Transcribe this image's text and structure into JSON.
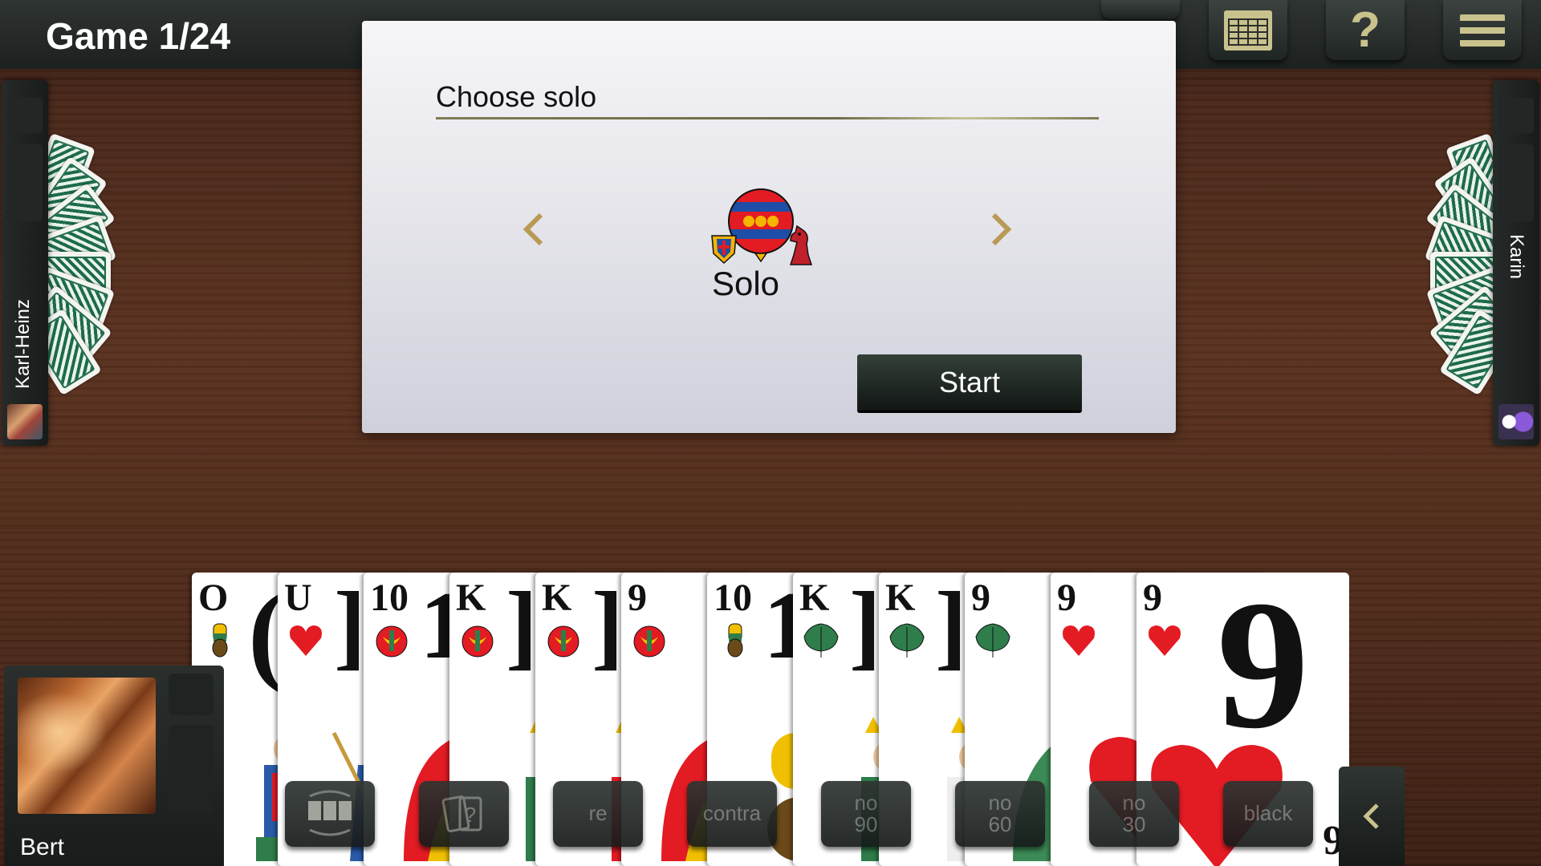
{
  "header": {
    "game_counter": "Game 1/24",
    "buttons": [
      {
        "name": "scoresheet-icon"
      },
      {
        "name": "help-icon"
      },
      {
        "name": "menu-icon"
      }
    ]
  },
  "opponents": {
    "left": {
      "name": "Karl-Heinz"
    },
    "right": {
      "name": "Karin"
    }
  },
  "dialog": {
    "title": "Choose solo",
    "selected_game": "Solo",
    "prev_label": "‹",
    "next_label": "›",
    "start_label": "Start"
  },
  "hand": {
    "cards": [
      {
        "rank": "O",
        "suit": "acorn"
      },
      {
        "rank": "U",
        "suit": "heart"
      },
      {
        "rank": "10",
        "suit": "bell"
      },
      {
        "rank": "K",
        "suit": "bell"
      },
      {
        "rank": "K",
        "suit": "bell"
      },
      {
        "rank": "9",
        "suit": "bell"
      },
      {
        "rank": "10",
        "suit": "acorn"
      },
      {
        "rank": "K",
        "suit": "leaf"
      },
      {
        "rank": "K",
        "suit": "leaf"
      },
      {
        "rank": "9",
        "suit": "leaf"
      },
      {
        "rank": "9",
        "suit": "heart"
      },
      {
        "rank": "9",
        "suit": "heart"
      }
    ],
    "corner_index": "6"
  },
  "player": {
    "name": "Bert"
  },
  "actions": {
    "re": "re",
    "contra": "contra",
    "no90_line1": "no",
    "no90_line2": "90",
    "no60_line1": "no",
    "no60_line2": "60",
    "no30_line1": "no",
    "no30_line2": "30",
    "black": "black",
    "collapse": "‹"
  },
  "colors": {
    "accent": "#c9c28c",
    "heart": "#e31b23",
    "leaf": "#2e7d4a",
    "bell": "#e31b23",
    "acorn": "#6b4a1a"
  }
}
